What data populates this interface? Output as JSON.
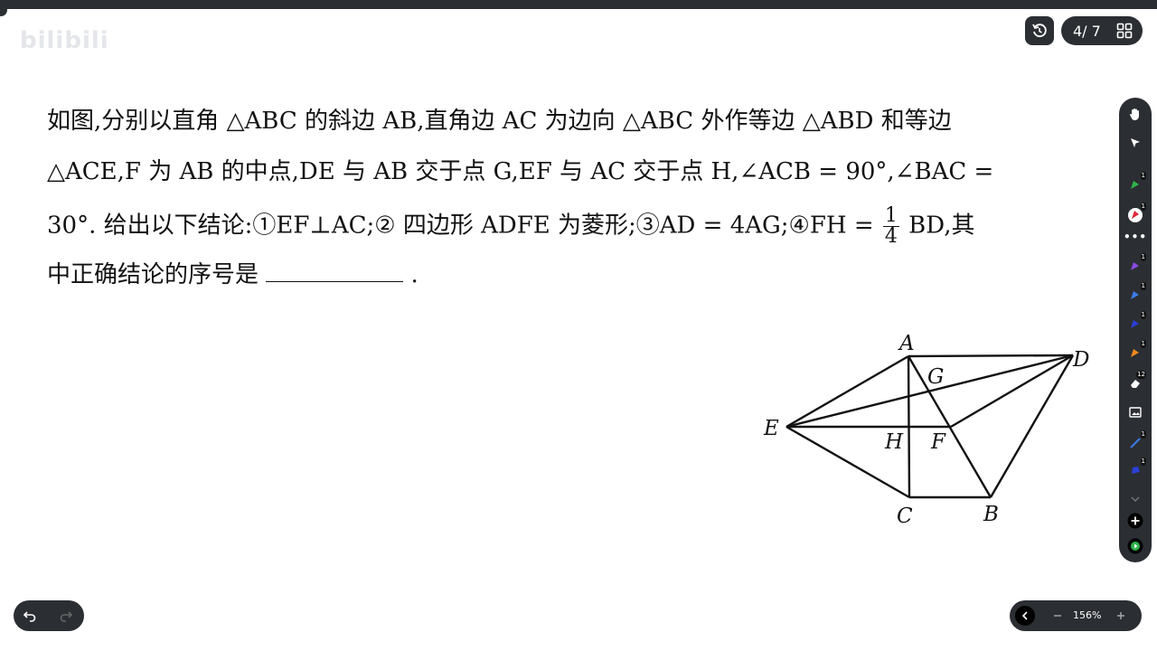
{
  "watermark": "bilibili",
  "pager": {
    "indicator": "4/ 7"
  },
  "question": {
    "line1": "如图,分别以直角 △ABC 的斜边 AB,直角边 AC 为边向 △ABC 外作等边 △ABD 和等边",
    "line2": "△ACE,F 为 AB 的中点,DE 与 AB 交于点 G,EF 与 AC 交于点 H,∠ACB = 90°,∠BAC =",
    "line3_a": "30°. 给出以下结论:①EF⊥AC;② 四边形 ADFE 为菱形;③AD = 4AG;④FH =",
    "frac_num": "1",
    "frac_den": "4",
    "line3_b": "BD,其",
    "line4": "中正确结论的序号是",
    "line4_end": "."
  },
  "figure": {
    "points": {
      "A": "A",
      "B": "B",
      "C": "C",
      "D": "D",
      "E": "E",
      "F": "F",
      "G": "G",
      "H": "H"
    }
  },
  "toolbar": {
    "items": [
      {
        "icon": "hand-icon"
      },
      {
        "icon": "cursor-icon"
      },
      {
        "icon": "pen-green-icon",
        "badge": "1",
        "color": "#2fb24a"
      },
      {
        "icon": "pen-red-icon",
        "badge": "1",
        "color": "#e0293b"
      },
      {
        "icon": "more-icon"
      },
      {
        "icon": "pen-purple-icon",
        "badge": "1",
        "color": "#8a4de0"
      },
      {
        "icon": "pen-blue-icon",
        "badge": "1",
        "color": "#3b7be8"
      },
      {
        "icon": "pen-navy-icon",
        "badge": "1",
        "color": "#2c3fd6"
      },
      {
        "icon": "pen-orange-icon",
        "badge": "1",
        "color": "#f08a1e"
      },
      {
        "icon": "eraser-icon",
        "badge": "12"
      },
      {
        "icon": "image-icon"
      },
      {
        "icon": "line-tool-icon",
        "badge": "1",
        "color": "#3b7be8"
      },
      {
        "icon": "shape-blue-icon",
        "badge": "1",
        "color": "#2c3fd6"
      },
      {
        "icon": "chevron-down-icon"
      },
      {
        "icon": "add-icon"
      },
      {
        "icon": "green-play-icon",
        "color": "#2fb24a"
      }
    ]
  },
  "zoom": {
    "value": "156%"
  }
}
